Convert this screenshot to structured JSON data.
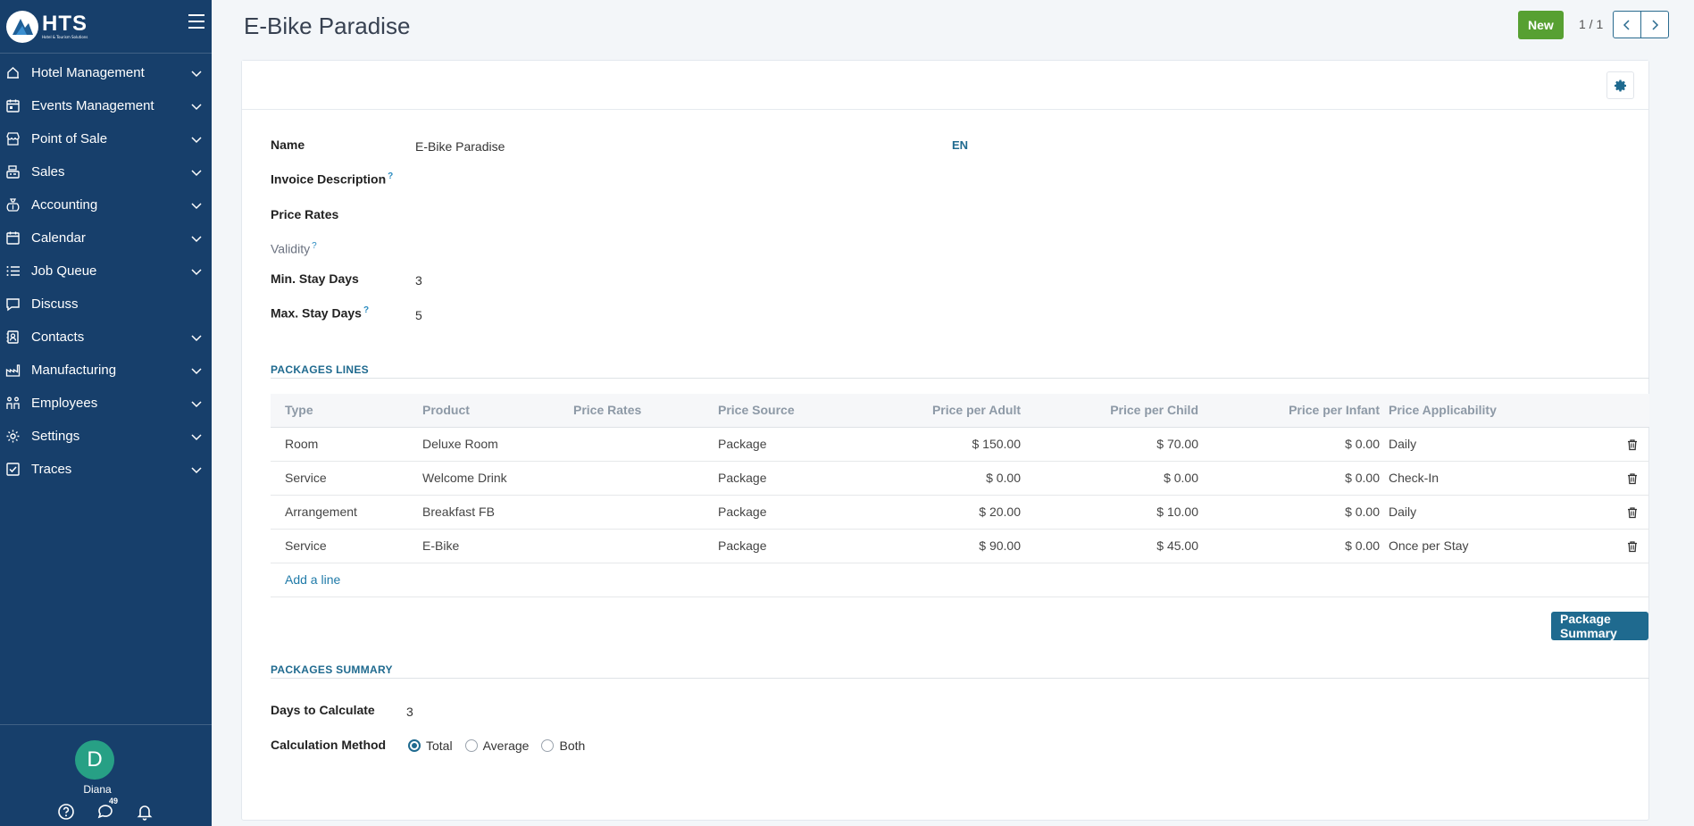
{
  "brand": {
    "logo_text": "HTS",
    "logo_subtext": "Hotel & Tourism Solutions"
  },
  "sidebar": {
    "items": [
      {
        "label": "Hotel Management",
        "icon": "hotel-icon",
        "has_chevron": true
      },
      {
        "label": "Events Management",
        "icon": "calendar-event-icon",
        "has_chevron": true
      },
      {
        "label": "Point of Sale",
        "icon": "store-icon",
        "has_chevron": true
      },
      {
        "label": "Sales",
        "icon": "cash-register-icon",
        "has_chevron": true
      },
      {
        "label": "Accounting",
        "icon": "money-bag-icon",
        "has_chevron": true
      },
      {
        "label": "Calendar",
        "icon": "calendar-icon",
        "has_chevron": true
      },
      {
        "label": "Job Queue",
        "icon": "list-icon",
        "has_chevron": true
      },
      {
        "label": "Discuss",
        "icon": "chat-icon",
        "has_chevron": false
      },
      {
        "label": "Contacts",
        "icon": "contacts-icon",
        "has_chevron": true
      },
      {
        "label": "Manufacturing",
        "icon": "factory-icon",
        "has_chevron": true
      },
      {
        "label": "Employees",
        "icon": "employees-icon",
        "has_chevron": true
      },
      {
        "label": "Settings",
        "icon": "gear-icon",
        "has_chevron": true
      },
      {
        "label": "Traces",
        "icon": "checkbox-icon",
        "has_chevron": true
      }
    ],
    "user": {
      "initial": "D",
      "name": "Diana"
    },
    "message_count": "49"
  },
  "header": {
    "title": "E-Bike Paradise",
    "new_label": "New",
    "pager": "1 / 1"
  },
  "form": {
    "name_label": "Name",
    "name_value": "E-Bike Paradise",
    "lang": "EN",
    "invoice_description_label": "Invoice Description",
    "price_rates_label": "Price Rates",
    "validity_label": "Validity",
    "min_stay_label": "Min. Stay Days",
    "min_stay_value": "3",
    "max_stay_label": "Max. Stay Days",
    "max_stay_value": "5",
    "help_mark": "?"
  },
  "packages_lines": {
    "title": "PACKAGES LINES",
    "columns": [
      "Type",
      "Product",
      "Price Rates",
      "Price Source",
      "Price per Adult",
      "Price per Child",
      "Price per Infant",
      "Price Applicability"
    ],
    "rows": [
      {
        "type": "Room",
        "product": "Deluxe Room",
        "price_rates": "",
        "price_source": "Package",
        "adult": "$ 150.00",
        "child": "$ 70.00",
        "infant": "$ 0.00",
        "applicability": "Daily"
      },
      {
        "type": "Service",
        "product": "Welcome Drink",
        "price_rates": "",
        "price_source": "Package",
        "adult": "$ 0.00",
        "child": "$ 0.00",
        "infant": "$ 0.00",
        "applicability": "Check-In"
      },
      {
        "type": "Arrangement",
        "product": "Breakfast FB",
        "price_rates": "",
        "price_source": "Package",
        "adult": "$ 20.00",
        "child": "$ 10.00",
        "infant": "$ 0.00",
        "applicability": "Daily"
      },
      {
        "type": "Service",
        "product": "E-Bike",
        "price_rates": "",
        "price_source": "Package",
        "adult": "$ 90.00",
        "child": "$ 45.00",
        "infant": "$ 0.00",
        "applicability": "Once per Stay"
      }
    ],
    "add_line_label": "Add a line",
    "summary_button_label": "Package Summary"
  },
  "packages_summary": {
    "title": "PACKAGES SUMMARY",
    "days_label": "Days to Calculate",
    "days_value": "3",
    "method_label": "Calculation Method",
    "methods": [
      "Total",
      "Average",
      "Both"
    ],
    "selected_method": "Total"
  },
  "colors": {
    "sidebar_bg": "#173f6b",
    "accent": "#1f6a8f",
    "new_button": "#57a032",
    "avatar": "#27a085"
  }
}
